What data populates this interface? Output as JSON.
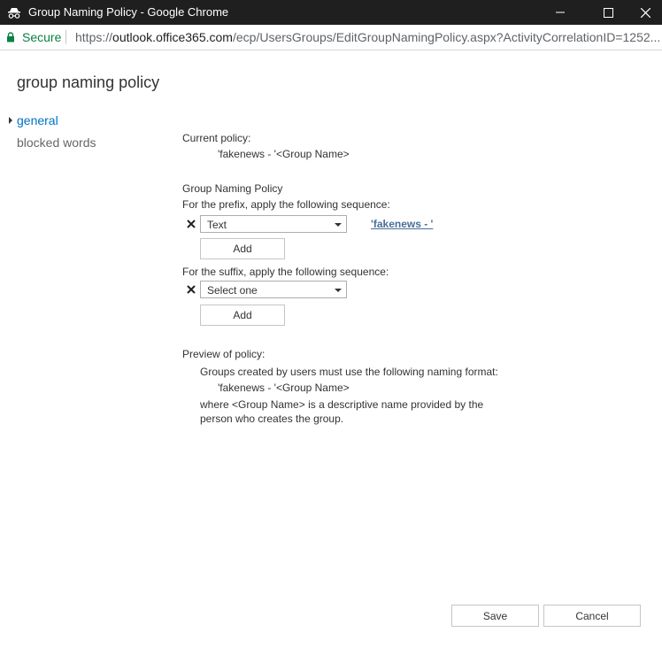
{
  "window": {
    "title": "Group Naming Policy - Google Chrome",
    "minimize_icon": "minimize-icon",
    "maximize_icon": "maximize-icon",
    "close_icon": "close-icon"
  },
  "address_bar": {
    "secure_label": "Secure",
    "url_scheme": "https://",
    "url_host": "outlook.office365.com",
    "url_path": "/ecp/UsersGroups/EditGroupNamingPolicy.aspx?ActivityCorrelationID=1252..."
  },
  "page": {
    "title": "group naming policy"
  },
  "nav": {
    "items": [
      {
        "label": "general"
      },
      {
        "label": "blocked words"
      }
    ]
  },
  "current_policy": {
    "label": "Current policy:",
    "value": "'fakenews - '<Group Name>"
  },
  "naming_policy": {
    "heading": "Group Naming Policy"
  },
  "prefix": {
    "label": "For the prefix, apply the following sequence:",
    "select_value": "Text",
    "text_value": "'fakenews - '",
    "add_label": "Add"
  },
  "suffix": {
    "label": "For the suffix, apply the following sequence:",
    "select_value": "Select one",
    "add_label": "Add"
  },
  "preview": {
    "label": "Preview of policy:",
    "intro": "Groups created by users must use the following naming format:",
    "format": "'fakenews - '<Group Name>",
    "note_line1": "where <Group Name> is a descriptive name provided by the",
    "note_line2": "person who creates the group."
  },
  "footer": {
    "save_label": "Save",
    "cancel_label": "Cancel"
  },
  "colors": {
    "titlebar": "#1f1f1f",
    "secure": "#0b8043",
    "nav_active": "#0072c6",
    "link": "#4a6f9a"
  }
}
